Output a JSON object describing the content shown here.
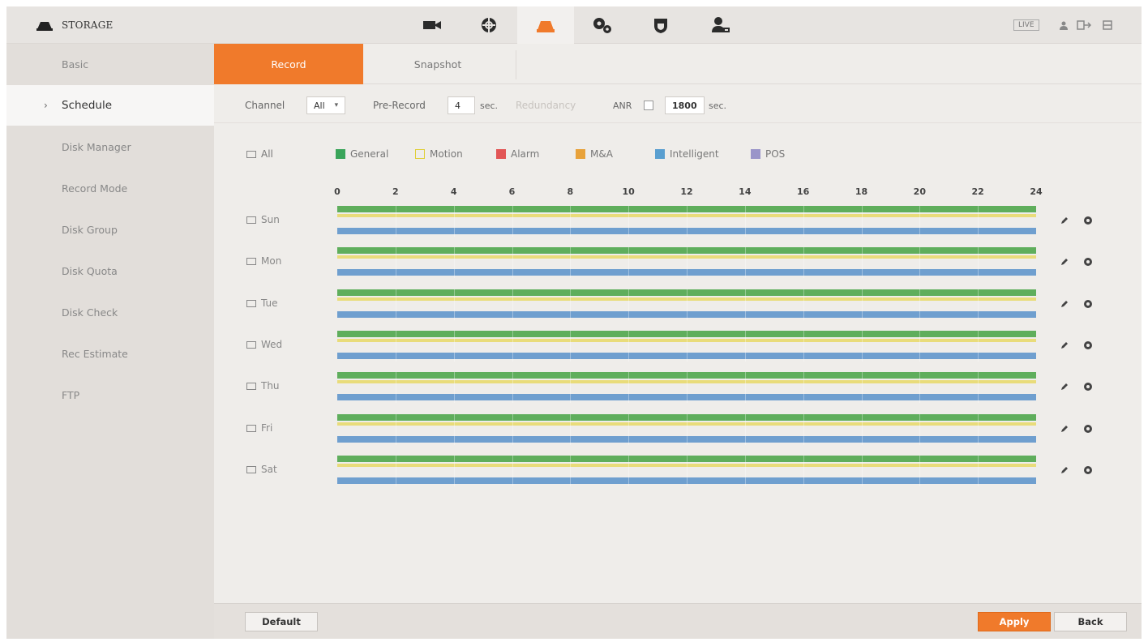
{
  "app": {
    "section_title": "STORAGE",
    "live_label": "LIVE"
  },
  "nav_icons": [
    "camera-icon",
    "network-icon",
    "storage-icon",
    "system-icon",
    "security-icon",
    "account-icon"
  ],
  "sidebar": {
    "items": [
      {
        "label": "Basic",
        "active": false
      },
      {
        "label": "Schedule",
        "active": true
      },
      {
        "label": "Disk Manager",
        "active": false
      },
      {
        "label": "Record Mode",
        "active": false
      },
      {
        "label": "Disk Group",
        "active": false
      },
      {
        "label": "Disk Quota",
        "active": false
      },
      {
        "label": "Disk Check",
        "active": false
      },
      {
        "label": "Rec Estimate",
        "active": false
      },
      {
        "label": "FTP",
        "active": false
      }
    ]
  },
  "tabs": [
    {
      "label": "Record",
      "active": true
    },
    {
      "label": "Snapshot",
      "active": false
    }
  ],
  "settings": {
    "channel_label": "Channel",
    "channel_value": "All",
    "prerecord_label": "Pre-Record",
    "prerecord_value": "4",
    "prerecord_unit": "sec.",
    "redundancy_label": "Redundancy",
    "anr_label": "ANR",
    "anr_value": "1800",
    "anr_unit": "sec."
  },
  "legend": {
    "all_label": "All",
    "items": [
      {
        "label": "General",
        "color": "#3aa55a",
        "checked": true
      },
      {
        "label": "Motion",
        "color": "#f2e04a",
        "checked": false
      },
      {
        "label": "Alarm",
        "color": "#e25656",
        "checked": true
      },
      {
        "label": "M&A",
        "color": "#e8a23a",
        "checked": true
      },
      {
        "label": "Intelligent",
        "color": "#5a9fd0",
        "checked": true
      },
      {
        "label": "POS",
        "color": "#9a95c9",
        "checked": true
      }
    ]
  },
  "timeline": {
    "ticks": [
      "0",
      "2",
      "4",
      "6",
      "8",
      "10",
      "12",
      "14",
      "16",
      "18",
      "20",
      "22",
      "24"
    ]
  },
  "schedule": {
    "days": [
      "Sun",
      "Mon",
      "Tue",
      "Wed",
      "Thu",
      "Fri",
      "Sat"
    ],
    "segments": [
      {
        "type": "General",
        "start": 0,
        "end": 24
      },
      {
        "type": "Motion",
        "start": 0,
        "end": 24
      },
      {
        "type": "Intelligent",
        "start": 0,
        "end": 24
      }
    ]
  },
  "footer": {
    "default_label": "Default",
    "apply_label": "Apply",
    "back_label": "Back"
  }
}
